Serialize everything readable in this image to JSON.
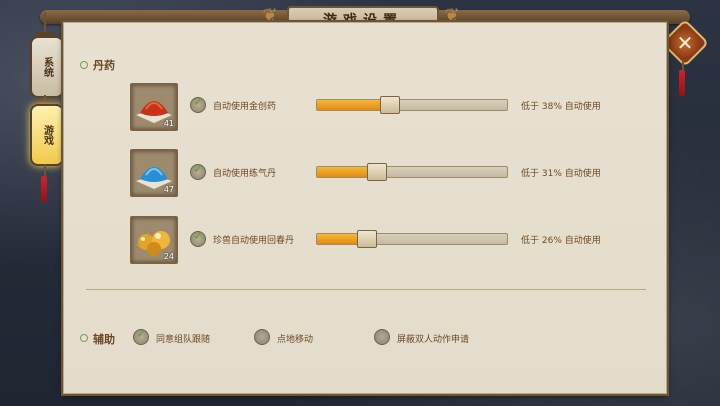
{
  "title": "游戏设置",
  "side_tabs": [
    {
      "label": "系统"
    },
    {
      "label": "游戏"
    }
  ],
  "sections": {
    "potions": {
      "heading": "丹药",
      "rows": [
        {
          "icon": "red-powder-icon",
          "count": "41",
          "label": "自动使用金创药",
          "threshold_label": "低于 38% 自动使用",
          "checked": true,
          "level_percent": 38
        },
        {
          "icon": "blue-powder-icon",
          "count": "47",
          "label": "自动使用练气丹",
          "threshold_label": "低于 31% 自动使用",
          "checked": true,
          "level_percent": 31
        },
        {
          "icon": "golden-pills-icon",
          "count": "24",
          "label": "珍兽自动使用回春丹",
          "threshold_label": "低于 26% 自动使用",
          "checked": true,
          "level_percent": 26
        }
      ]
    },
    "assist": {
      "heading": "辅助",
      "options": [
        {
          "label": "同意组队跟随",
          "checked": true
        },
        {
          "label": "点地移动",
          "checked": false
        },
        {
          "label": "屏蔽双人动作申请",
          "checked": false
        }
      ]
    }
  },
  "colors": {
    "accent": "#e08c14",
    "panel": "#e8e0d0",
    "check_green": "#5ea623"
  }
}
